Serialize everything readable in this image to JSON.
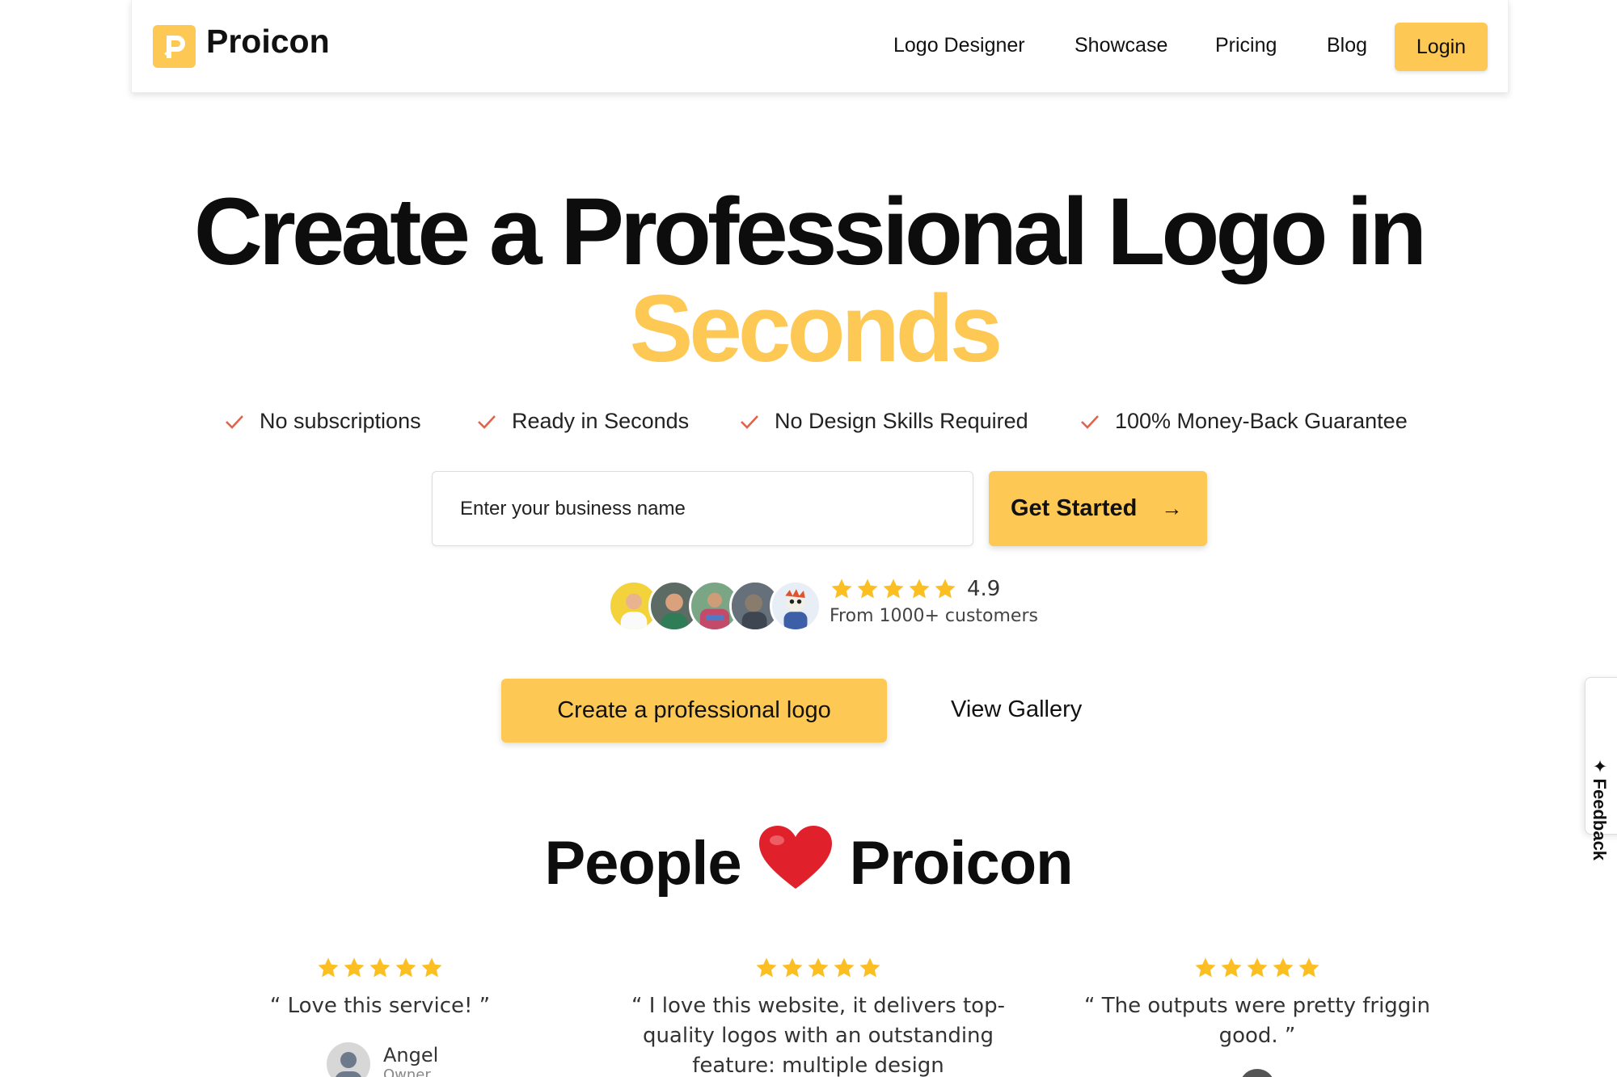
{
  "nav": {
    "brand": "Proicon",
    "links": [
      "Logo Designer",
      "Showcase",
      "Pricing",
      "Blog"
    ],
    "login": "Login"
  },
  "hero": {
    "line1": "Create a Professional Logo in",
    "line2": "Seconds"
  },
  "features": [
    "No subscriptions",
    "Ready in Seconds",
    "No Design Skills Required",
    "100% Money-Back Guarantee"
  ],
  "cta": {
    "placeholder": "Enter your business name",
    "get_started": "Get Started",
    "arrow": "→"
  },
  "rating": {
    "value": "4.9",
    "stars": 5,
    "subtext": "From 1000+ customers"
  },
  "buttons": {
    "create": "Create a professional logo",
    "gallery": "View Gallery"
  },
  "testimonials": {
    "title_left": "People",
    "title_right": "Proicon",
    "items": [
      {
        "quote": "“ Love this service! ”",
        "name": "Angel",
        "role": "Owner",
        "stars": 5
      },
      {
        "quote": "“ I love this website, it delivers top-quality logos with an outstanding feature: multiple design",
        "stars": 5
      },
      {
        "quote": "“ The outputs were pretty friggin good. ”",
        "stars": 5
      }
    ]
  },
  "feedback": "Feedback",
  "colors": {
    "accent": "#fdc854",
    "check": "#e2634a",
    "star": "#fbbf24"
  }
}
